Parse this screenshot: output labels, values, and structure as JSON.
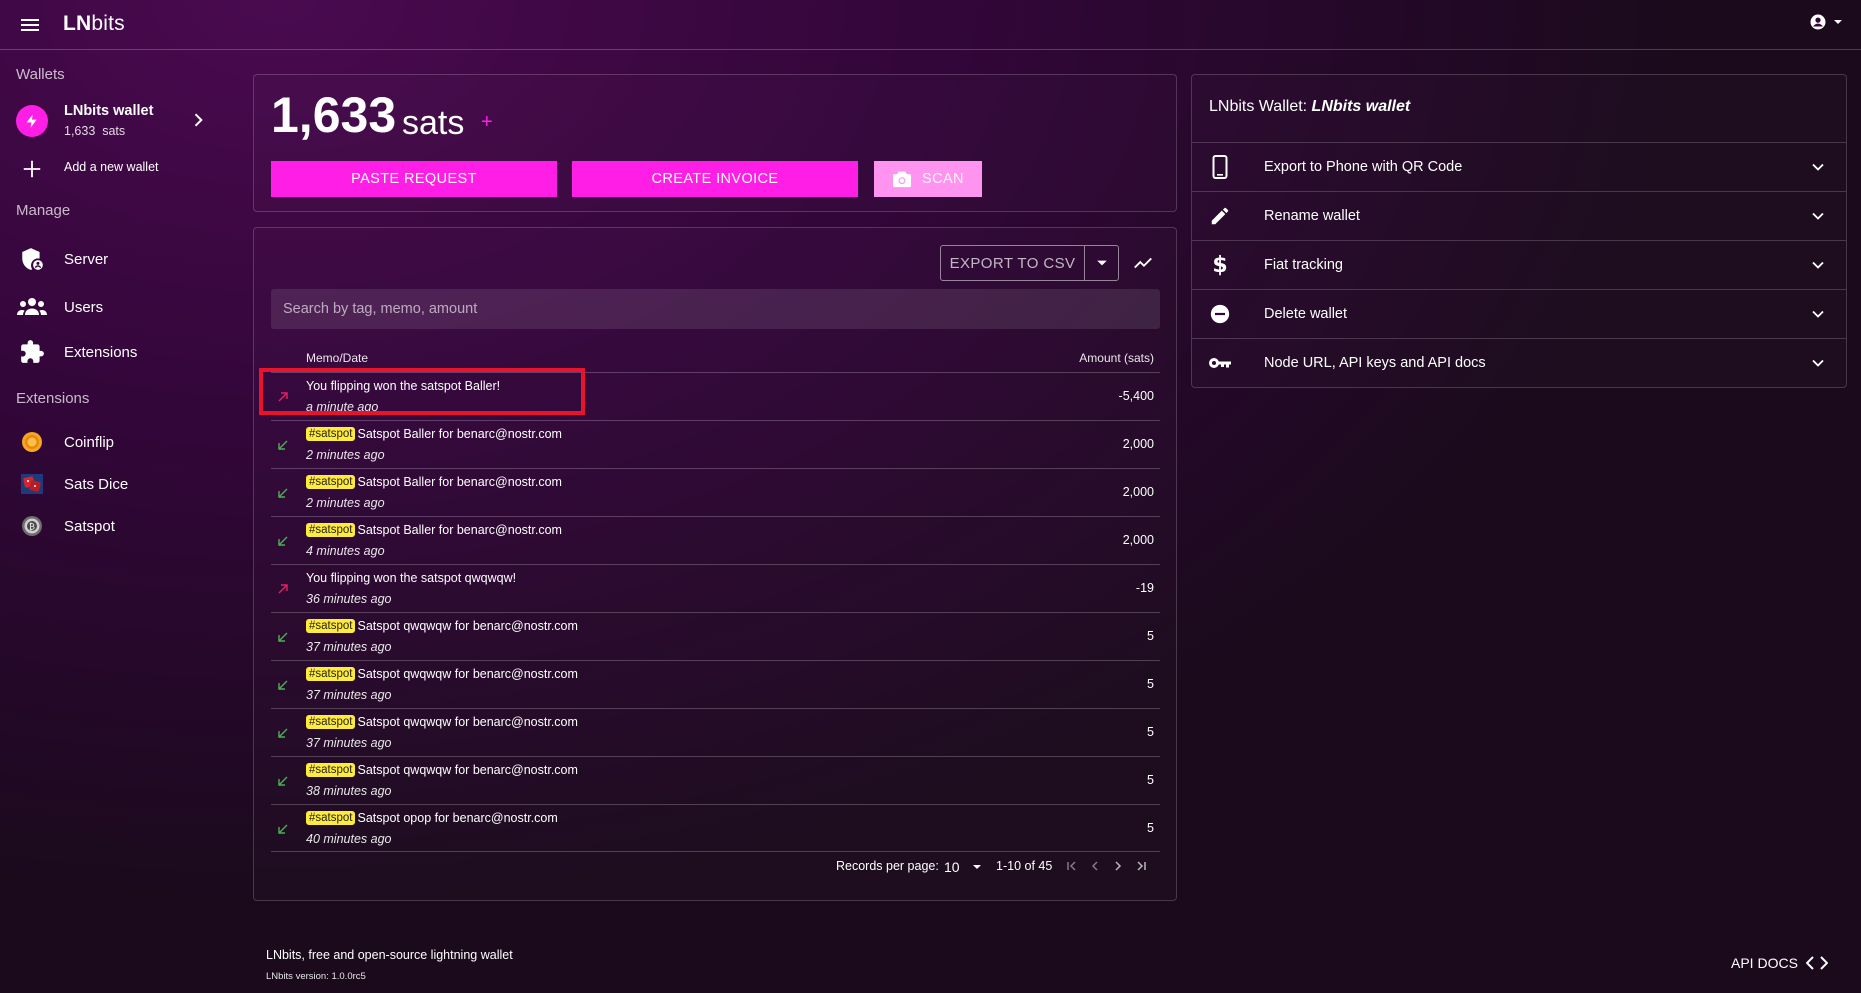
{
  "header": {
    "brand_bold": "LN",
    "brand_rest": "bits"
  },
  "sidebar": {
    "wallets_title": "Wallets",
    "wallet": {
      "name": "LNbits wallet",
      "balance": "1,633",
      "unit": "sats"
    },
    "add_wallet": "Add a new wallet",
    "manage_title": "Manage",
    "manage_items": [
      "Server",
      "Users",
      "Extensions"
    ],
    "extensions_title": "Extensions",
    "extensions": [
      "Coinflip",
      "Sats Dice",
      "Satspot"
    ]
  },
  "balance": {
    "amount": "1,633",
    "unit": "sats",
    "plus": "+",
    "paste_label": "PASTE REQUEST",
    "create_label": "CREATE INVOICE",
    "scan_label": "SCAN"
  },
  "transactions": {
    "export_label": "EXPORT TO CSV",
    "search_placeholder": "Search by tag, memo, amount",
    "col_memo": "Memo/Date",
    "col_amount": "Amount (sats)",
    "rows": [
      {
        "dir": "out",
        "tag": "",
        "memo": "You flipping won the satspot Baller!",
        "date": "a minute ago",
        "amount": "-5,400"
      },
      {
        "dir": "in",
        "tag": "#satspot",
        "memo": "Satspot Baller for benarc@nostr.com",
        "date": "2 minutes ago",
        "amount": "2,000"
      },
      {
        "dir": "in",
        "tag": "#satspot",
        "memo": "Satspot Baller for benarc@nostr.com",
        "date": "2 minutes ago",
        "amount": "2,000"
      },
      {
        "dir": "in",
        "tag": "#satspot",
        "memo": "Satspot Baller for benarc@nostr.com",
        "date": "4 minutes ago",
        "amount": "2,000"
      },
      {
        "dir": "out",
        "tag": "",
        "memo": "You flipping won the satspot qwqwqw!",
        "date": "36 minutes ago",
        "amount": "-19"
      },
      {
        "dir": "in",
        "tag": "#satspot",
        "memo": "Satspot qwqwqw for benarc@nostr.com",
        "date": "37 minutes ago",
        "amount": "5"
      },
      {
        "dir": "in",
        "tag": "#satspot",
        "memo": "Satspot qwqwqw for benarc@nostr.com",
        "date": "37 minutes ago",
        "amount": "5"
      },
      {
        "dir": "in",
        "tag": "#satspot",
        "memo": "Satspot qwqwqw for benarc@nostr.com",
        "date": "37 minutes ago",
        "amount": "5"
      },
      {
        "dir": "in",
        "tag": "#satspot",
        "memo": "Satspot qwqwqw for benarc@nostr.com",
        "date": "38 minutes ago",
        "amount": "5"
      },
      {
        "dir": "in",
        "tag": "#satspot",
        "memo": "Satspot opop for benarc@nostr.com",
        "date": "40 minutes ago",
        "amount": "5"
      }
    ],
    "records_label": "Records per page:",
    "records_value": "10",
    "range": "1-10 of 45"
  },
  "wallet_card": {
    "title_prefix": "LNbits Wallet: ",
    "title_name": "LNbits wallet",
    "items": [
      "Export to Phone with QR Code",
      "Rename wallet",
      "Fiat tracking",
      "Delete wallet",
      "Node URL, API keys and API docs"
    ]
  },
  "footer": {
    "text": "LNbits, free and open-source lightning wallet",
    "version": "LNbits version: 1.0.0rc5",
    "api_docs": "API DOCS"
  },
  "colors": {
    "accent": "#ff1ee6",
    "tag_bg": "#ffeb3b",
    "in_arrow": "#4caf50",
    "out_arrow": "#e91e63",
    "highlight": "#e8132c"
  }
}
